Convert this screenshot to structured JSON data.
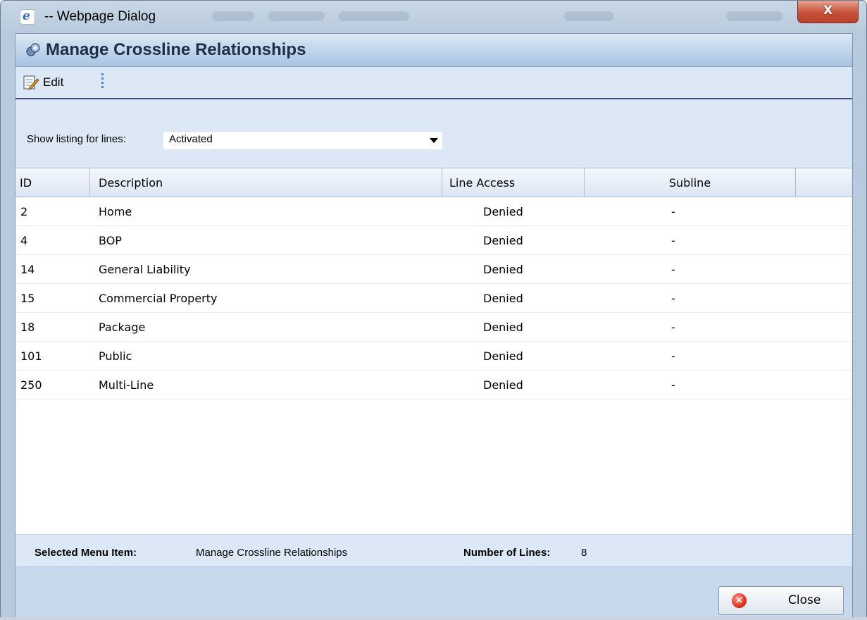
{
  "window": {
    "title": "-- Webpage Dialog",
    "close_glyph": "X"
  },
  "dialog": {
    "title": "Manage Crossline Relationships"
  },
  "toolbar": {
    "edit_label": "Edit"
  },
  "filter": {
    "label": "Show listing for lines:",
    "selected": "Activated"
  },
  "table": {
    "columns": [
      "ID",
      "Description",
      "Line Access",
      "Subline"
    ],
    "rows": [
      {
        "id": "2",
        "description": "Home",
        "line_access": "Denied",
        "subline": "-"
      },
      {
        "id": "4",
        "description": "BOP",
        "line_access": "Denied",
        "subline": "-"
      },
      {
        "id": "14",
        "description": "General Liability",
        "line_access": "Denied",
        "subline": "-"
      },
      {
        "id": "15",
        "description": "Commercial Property",
        "line_access": "Denied",
        "subline": "-"
      },
      {
        "id": "18",
        "description": "Package",
        "line_access": "Denied",
        "subline": "-"
      },
      {
        "id": "101",
        "description": "Public",
        "line_access": "Denied",
        "subline": "-"
      },
      {
        "id": "250",
        "description": "Multi-Line",
        "line_access": "Denied",
        "subline": "-"
      }
    ]
  },
  "status": {
    "selected_menu_label": "Selected Menu Item:",
    "selected_menu_value": "Manage Crossline Relationships",
    "lines_label": "Number of Lines:",
    "lines_value": "8"
  },
  "footer": {
    "close_label": "Close"
  },
  "colors": {
    "header_title": "#1d2e48",
    "toolbar_bg": "#dde8f6",
    "footer_bg": "#c8d9ee",
    "window_close": "#c7503a"
  },
  "icons": {
    "window": "ie-icon",
    "header": "relationships-icon",
    "edit": "edit-icon",
    "close": "close-icon"
  }
}
